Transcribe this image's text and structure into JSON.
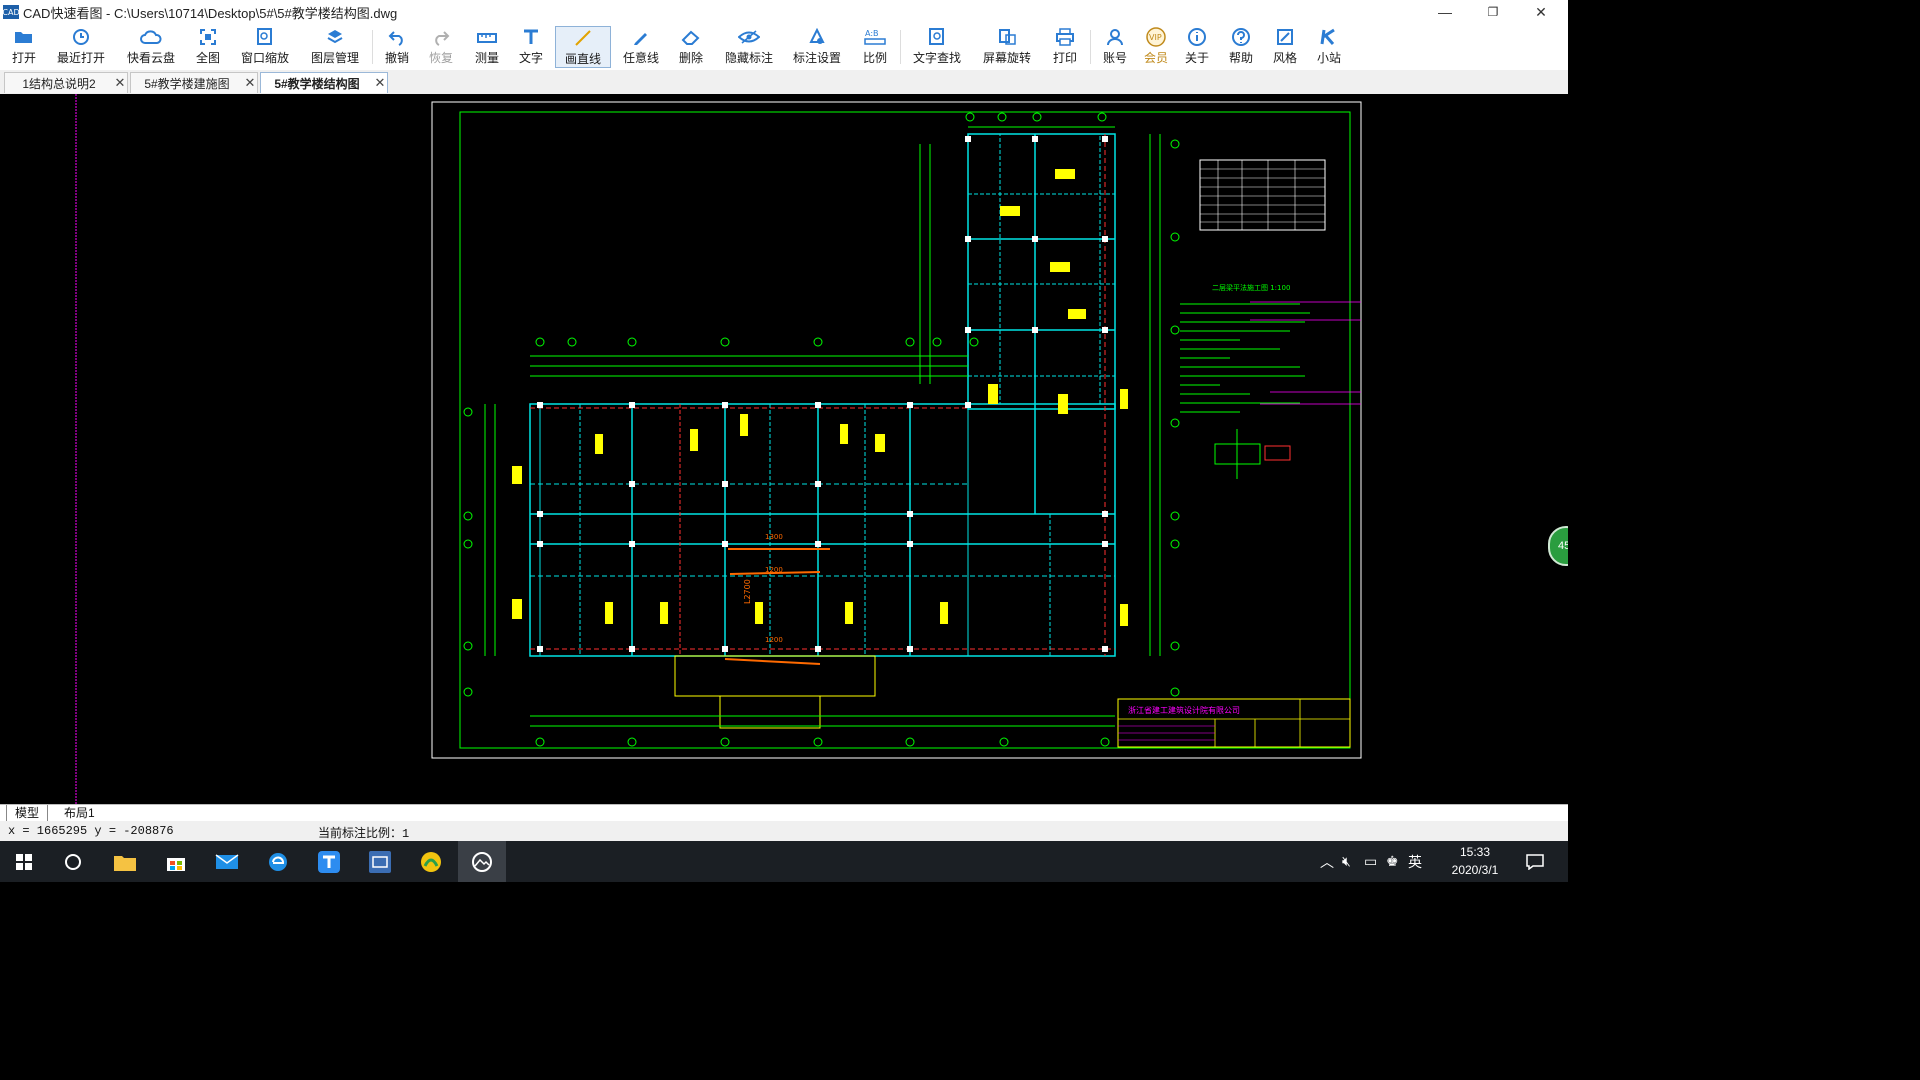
{
  "app": {
    "logo_text": "CAD",
    "title": "CAD快速看图 - C:\\Users\\10714\\Desktop\\5#\\5#教学楼结构图.dwg"
  },
  "window_controls": {
    "minimize": "—",
    "maximize": "❐",
    "close": "✕"
  },
  "toolbar": {
    "open": "打开",
    "recent": "最近打开",
    "cloud": "快看云盘",
    "fit": "全图",
    "window_zoom": "窗口缩放",
    "layers": "图层管理",
    "undo": "撤销",
    "redo": "恢复",
    "measure": "测量",
    "text": "文字",
    "line": "画直线",
    "freeline": "任意线",
    "delete": "删除",
    "hide_dim": "隐藏标注",
    "dim_settings": "标注设置",
    "scale": "比例",
    "text_find": "文字查找",
    "rotate": "屏幕旋转",
    "print": "打印",
    "account": "账号",
    "vip": "会员",
    "about": "关于",
    "help": "帮助",
    "style": "风格",
    "site": "小站"
  },
  "toolbar_icons": {
    "scale_icon_text": "A:B",
    "vip_icon_text": "VIP"
  },
  "tabs": [
    {
      "label": "1结构总说明2",
      "close": "✕"
    },
    {
      "label": "5#教学楼建施图",
      "close": "✕"
    },
    {
      "label": "5#教学楼结构图",
      "close": "✕",
      "active": true
    }
  ],
  "drawing": {
    "titleblock_company": "浙江省建工建筑设计院有限公司",
    "notes_title": "二层梁平法施工图  1:100",
    "dim_labels": [
      "1300",
      "1200",
      "1200",
      "L2700",
      "1200",
      "1200"
    ]
  },
  "side_badge": "45",
  "layouts": [
    {
      "label": "模型",
      "active": true
    },
    {
      "label": "布局1",
      "active": false
    }
  ],
  "status": {
    "coords": "x = 1665295 y = -208876",
    "scale": "当前标注比例：1"
  },
  "taskbar": {
    "tray_ime": "英",
    "time": "15:33",
    "date": "2020/3/1"
  },
  "colors": {
    "accent_blue": "#2b7cd3",
    "cad_green": "#00ff00",
    "cad_cyan": "#00e5e5",
    "cad_yellow": "#ffff00",
    "cad_red": "#ff3030",
    "cad_magenta": "#ff00ff",
    "vip_gold": "#c08a1c"
  }
}
